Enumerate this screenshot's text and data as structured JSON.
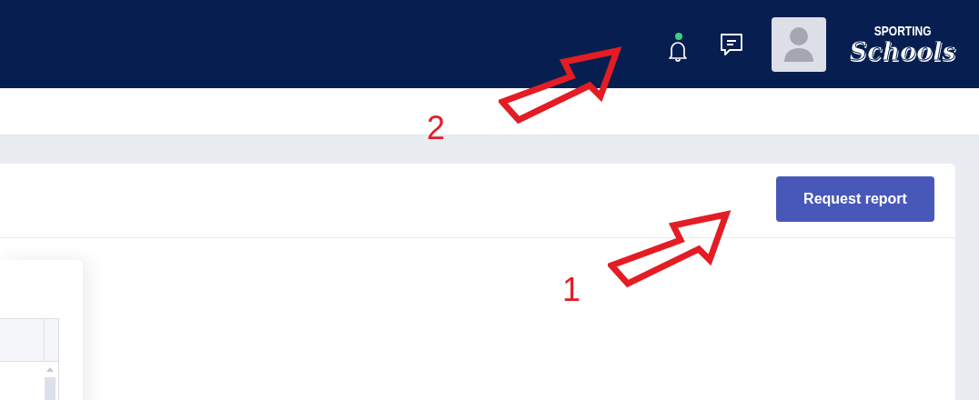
{
  "header": {
    "notifications": {
      "unread": true
    },
    "logo": {
      "top": "SPORTING",
      "bottom": "Schools"
    }
  },
  "card": {
    "button": "Request report"
  },
  "annotations": [
    {
      "label": "2",
      "kind": "arrow-up-right"
    },
    {
      "label": "1",
      "kind": "arrow-up-right"
    }
  ]
}
